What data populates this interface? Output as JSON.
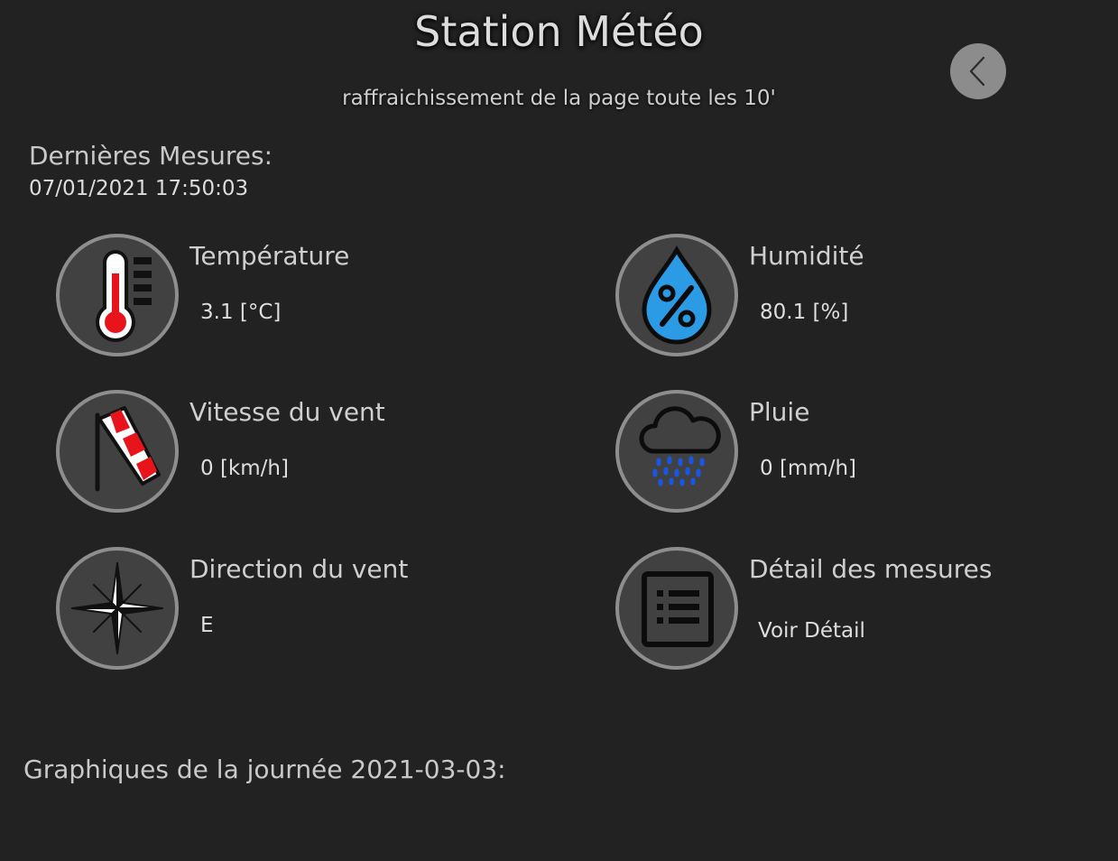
{
  "header": {
    "title": "Station Météo",
    "subtitle": "raffraichissement de la page toute les 10'",
    "back_icon": "chevron-left-icon"
  },
  "last_measures": {
    "label": "Dernières Mesures:",
    "datetime": "07/01/2021 17:50:03"
  },
  "tiles": [
    {
      "icon": "thermometer-icon",
      "label": "Température",
      "value": "3.1 [°C]"
    },
    {
      "icon": "humidity-drop-icon",
      "label": "Humidité",
      "value": "80.1 [%]"
    },
    {
      "icon": "windsock-icon",
      "label": "Vitesse du vent",
      "value": "0 [km/h]"
    },
    {
      "icon": "rain-cloud-icon",
      "label": "Pluie",
      "value": "0 [mm/h]"
    },
    {
      "icon": "compass-rose-icon",
      "label": "Direction du vent",
      "value": "E"
    },
    {
      "icon": "list-document-icon",
      "label": "Détail des mesures",
      "link": "Voir Détail"
    }
  ],
  "charts": {
    "title": "Graphiques de la journée 2021-03-03:"
  },
  "colors": {
    "background": "#222222",
    "icon_circle": "#414141",
    "icon_border": "#8e8e8e",
    "thermometer_red": "#e8141c",
    "drop_blue": "#2b9be6",
    "rain_blue": "#1a56e6",
    "windsock_red": "#e8141c"
  }
}
